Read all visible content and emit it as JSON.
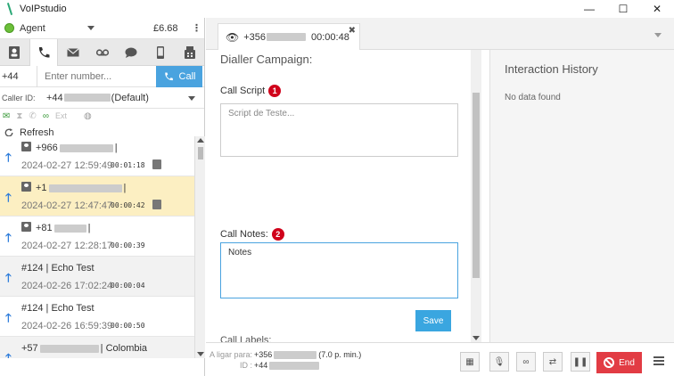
{
  "app": {
    "title": "VoIPstudio",
    "controls": [
      "—",
      "☐",
      "✕"
    ]
  },
  "agent": {
    "status_label": "Agent",
    "balance": "£6.68",
    "menu_icon": "kebab-icon"
  },
  "left_tabs": [
    "contacts-icon",
    "phone-icon",
    "email-icon",
    "voicemail-icon",
    "chat-icon",
    "mobile-icon",
    "fax-icon"
  ],
  "dialer": {
    "country_code": "+44",
    "placeholder": "Enter number...",
    "call_label": "Call"
  },
  "caller_id": {
    "label": "Caller ID:",
    "prefix": "+44",
    "suffix": "(Default)"
  },
  "status_bar": {
    "ext_label": "Ext"
  },
  "refresh_label": "Refresh",
  "calls": [
    {
      "number": "+966",
      "suffix": "|",
      "date": "2024-02-27 12:59:49",
      "duration": "00:01:18",
      "has_person": true,
      "has_note": true,
      "state": "normal"
    },
    {
      "number": "+1",
      "suffix": "|",
      "date": "2024-02-27 12:47:47",
      "duration": "00:00:42",
      "has_person": true,
      "has_note": true,
      "state": "selected"
    },
    {
      "number": "+81",
      "suffix": "|",
      "date": "2024-02-27 12:28:17",
      "duration": "00:00:39",
      "has_person": true,
      "has_note": false,
      "state": "normal"
    },
    {
      "number": "#124 | Echo Test",
      "suffix": "",
      "date": "2024-02-26 17:02:24",
      "duration": "00:00:04",
      "has_person": false,
      "has_note": false,
      "state": "grey"
    },
    {
      "number": "#124 | Echo Test",
      "suffix": "",
      "date": "2024-02-26 16:59:39",
      "duration": "00:00:50",
      "has_person": false,
      "has_note": false,
      "state": "normal"
    },
    {
      "number": "+57",
      "suffix": "| Colombia",
      "date": "",
      "duration": "",
      "has_person": false,
      "has_note": false,
      "state": "grey"
    }
  ],
  "active_call_tab": {
    "number": "+356",
    "time": "00:00:48"
  },
  "form": {
    "title": "Dialler Campaign:",
    "script_label": "Call Script",
    "script_badge": "1",
    "script_text": "Script de Teste...",
    "notes_label": "Call Notes:",
    "notes_badge": "2",
    "notes_text": "Notes",
    "save_label": "Save",
    "labels_label": "Call Labels:"
  },
  "history": {
    "title": "Interaction History",
    "empty": "No data found"
  },
  "bottom": {
    "dial_to_label": "A ligar para:",
    "dial_to_number": "+356",
    "rate": "(7.0 p. min.)",
    "id_label": "ID :",
    "id_number": "+44",
    "end_label": "End"
  },
  "colors": {
    "accent": "#3aa6e0",
    "end": "#e23c44",
    "selected_row": "#fcefc2",
    "badge": "#d0021b",
    "agent_status": "#6cbf3a"
  }
}
